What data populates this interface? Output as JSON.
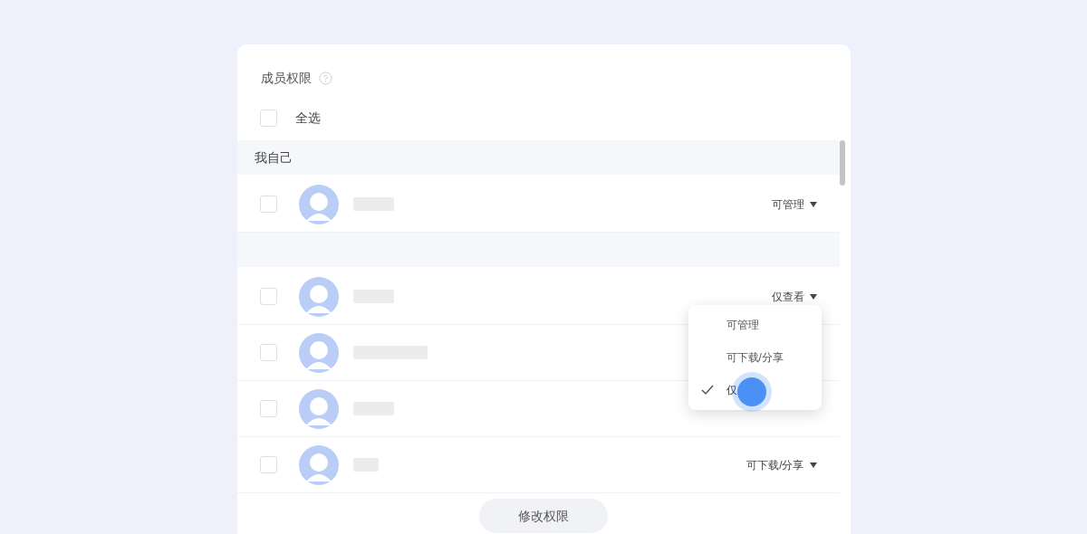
{
  "header": {
    "title": "成员权限"
  },
  "select_all": {
    "label": "全选",
    "checked": false
  },
  "sections": [
    {
      "title": "我自己",
      "members": [
        {
          "checked": false,
          "permission": "可管理"
        }
      ]
    },
    {
      "members": [
        {
          "checked": false,
          "permission": "仅查看"
        },
        {
          "checked": false
        },
        {
          "checked": false
        },
        {
          "checked": false,
          "permission": "可下载/分享"
        }
      ]
    }
  ],
  "permission_menu": {
    "items": [
      {
        "label": "可管理",
        "selected": false
      },
      {
        "label": "可下载/分享",
        "selected": false
      },
      {
        "label": "仅",
        "selected": true
      }
    ]
  },
  "button": "修改权限"
}
